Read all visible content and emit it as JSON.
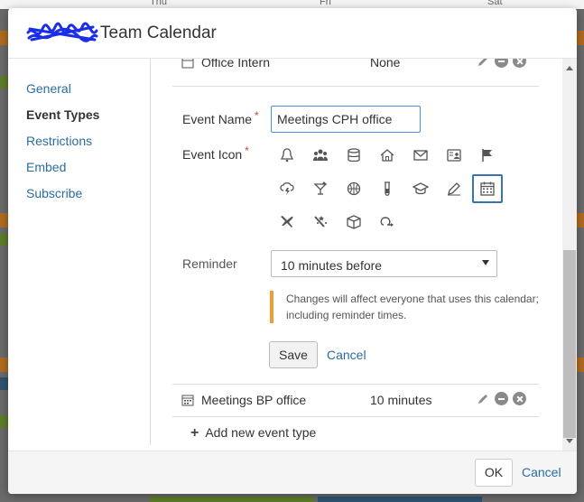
{
  "background": {
    "day_labels": [
      "Thu",
      "Fri",
      "Sat"
    ]
  },
  "dialog": {
    "title": "Team Calendar"
  },
  "sidebar": {
    "items": [
      {
        "label": "General"
      },
      {
        "label": "Event Types",
        "active": true
      },
      {
        "label": "Restrictions"
      },
      {
        "label": "Embed"
      },
      {
        "label": "Subscribe"
      }
    ]
  },
  "event_types": {
    "top_row": {
      "name": "Office Intern",
      "reminder": "None"
    },
    "bottom_row": {
      "name": "Meetings BP office",
      "reminder": "10 minutes"
    }
  },
  "form": {
    "event_name_label": "Event Name",
    "event_name_value": "Meetings CPH office",
    "event_icon_label": "Event Icon",
    "required_marker": "*",
    "icons": [
      "bell-icon",
      "people-icon",
      "database-icon",
      "home-icon",
      "envelope-icon",
      "id-card-icon",
      "flag-icon",
      "storm-icon",
      "cocktail-icon",
      "basketball-icon",
      "test-tube-icon",
      "graduation-cap-icon",
      "pencil-icon",
      "calendar-icon",
      "plane-icon",
      "magic-wand-icon",
      "box-icon",
      "loop-arrow-icon"
    ],
    "selected_icon": "calendar-icon",
    "reminder_label": "Reminder",
    "reminder_value": "10 minutes before",
    "warning_line1": "Changes will affect everyone that uses this calendar;",
    "warning_line2": "including reminder times.",
    "warning_color": "#f0a030",
    "save_label": "Save",
    "cancel_label": "Cancel"
  },
  "add_event_type_label": "Add new event type",
  "footer": {
    "ok_label": "OK",
    "cancel_label": "Cancel"
  },
  "colors": {
    "link": "#2a6ca3",
    "selected_border": "#3b73af",
    "required": "#d04437"
  }
}
